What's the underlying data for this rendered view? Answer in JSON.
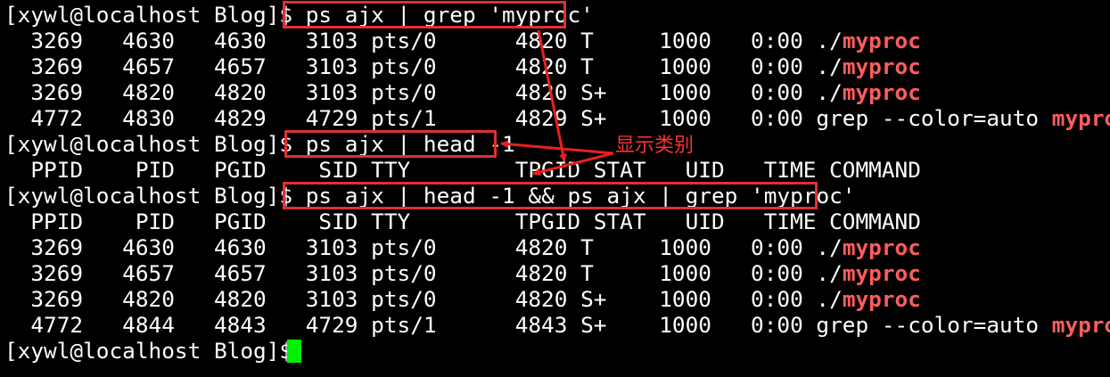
{
  "prompt": "[xywl@localhost Blog]$ ",
  "commands": {
    "cmd1": "ps ajx | grep 'myproc'",
    "cmd2": "ps ajx | head -1",
    "cmd3": "ps ajx | head -1 && ps ajx | grep 'myproc'"
  },
  "header": "  PPID    PID   PGID    SID TTY        TPGID STAT   UID   TIME COMMAND",
  "block1": [
    {
      "pre": "  3269   4630   4630   3103 pts/0      4820 T     1000   0:00 ./",
      "match": "myproc"
    },
    {
      "pre": "  3269   4657   4657   3103 pts/0      4820 T     1000   0:00 ./",
      "match": "myproc"
    },
    {
      "pre": "  3269   4820   4820   3103 pts/0      4820 S+    1000   0:00 ./",
      "match": "myproc"
    },
    {
      "pre": "  4772   4830   4829   4729 pts/1      4829 S+    1000   0:00 grep --color=auto ",
      "match": "myproc"
    }
  ],
  "block3": [
    {
      "pre": "  3269   4630   4630   3103 pts/0      4820 T     1000   0:00 ./",
      "match": "myproc"
    },
    {
      "pre": "  3269   4657   4657   3103 pts/0      4820 T     1000   0:00 ./",
      "match": "myproc"
    },
    {
      "pre": "  3269   4820   4820   3103 pts/0      4820 S+    1000   0:00 ./",
      "match": "myproc"
    },
    {
      "pre": "  4772   4844   4843   4729 pts/1      4843 S+    1000   0:00 grep --color=auto ",
      "match": "myproc"
    }
  ],
  "annotation": "显示类别",
  "colors": {
    "background": "#000000",
    "text": "#ffffff",
    "match": "#ff5c5c",
    "annotation": "#ff3030",
    "cursor": "#00ee00"
  }
}
